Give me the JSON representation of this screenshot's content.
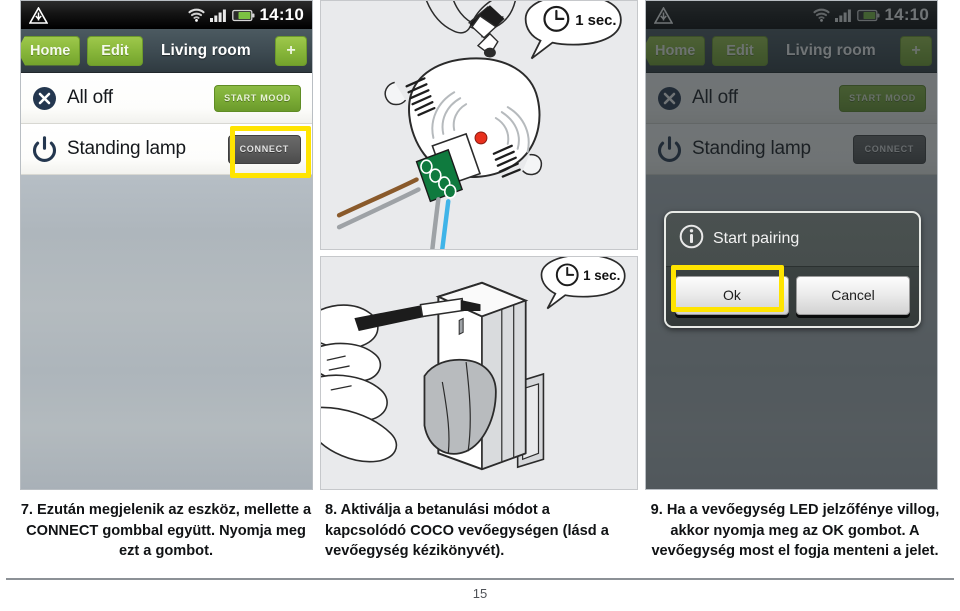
{
  "document": {
    "page_number": "15",
    "language": "hu"
  },
  "phone_left": {
    "status_bar": {
      "time": "14:10",
      "icons": [
        "warning-triangle-icon",
        "wifi-icon",
        "signal-bars-icon",
        "battery-icon"
      ]
    },
    "nav_bar": {
      "home_label": "Home",
      "edit_label": "Edit",
      "title": "Living room",
      "add_label": "+"
    },
    "rows": [
      {
        "icon": "close-circle-icon",
        "label": "All off",
        "button": "START MOOD",
        "button_style": "green"
      },
      {
        "icon": "power-icon",
        "label": "Standing lamp",
        "button": "CONNECT",
        "button_style": "gray"
      }
    ],
    "highlight": "connect-button"
  },
  "phone_right": {
    "status_bar": {
      "time": "14:10",
      "icons": [
        "warning-triangle-icon",
        "wifi-icon",
        "signal-bars-icon",
        "battery-icon"
      ]
    },
    "nav_bar": {
      "home_label": "Home",
      "edit_label": "Edit",
      "title": "Living room",
      "add_label": "+"
    },
    "rows": [
      {
        "icon": "close-circle-icon",
        "label": "All off",
        "button": "START MOOD",
        "button_style": "green"
      },
      {
        "icon": "power-icon",
        "label": "Standing lamp",
        "button": "CONNECT",
        "button_style": "gray"
      }
    ],
    "dialog": {
      "icon": "info-icon",
      "title": "Start pairing",
      "ok_label": "Ok",
      "cancel_label": "Cancel"
    },
    "highlight": "ok-button"
  },
  "illustrations": [
    {
      "name": "built-in-receiver-press-button",
      "bubble_text": "1 sec.",
      "bubble_icon": "clock-icon"
    },
    {
      "name": "plug-in-receiver-press-button",
      "bubble_text": "1 sec.",
      "bubble_icon": "clock-icon"
    }
  ],
  "captions": {
    "step7": "7. Ezután megjelenik az eszköz, mellette a CONNECT gombbal együtt. Nyomja meg ezt a gombot.",
    "step8": "8. Aktiválja a betanulási módot a kapcsolódó COCO vevőegységen (lásd a vevőegység kézikönyvét).",
    "step9": "9. Ha a vevőegység LED jelzőfénye villog, akkor nyomja meg az OK gombot. A vevőegység most el fogja menteni a jelet."
  },
  "colors": {
    "highlight_yellow": "#ffe400",
    "accent_green": "#86b539",
    "nav_dark": "#3d4a51",
    "icon_navy": "#24374f"
  }
}
